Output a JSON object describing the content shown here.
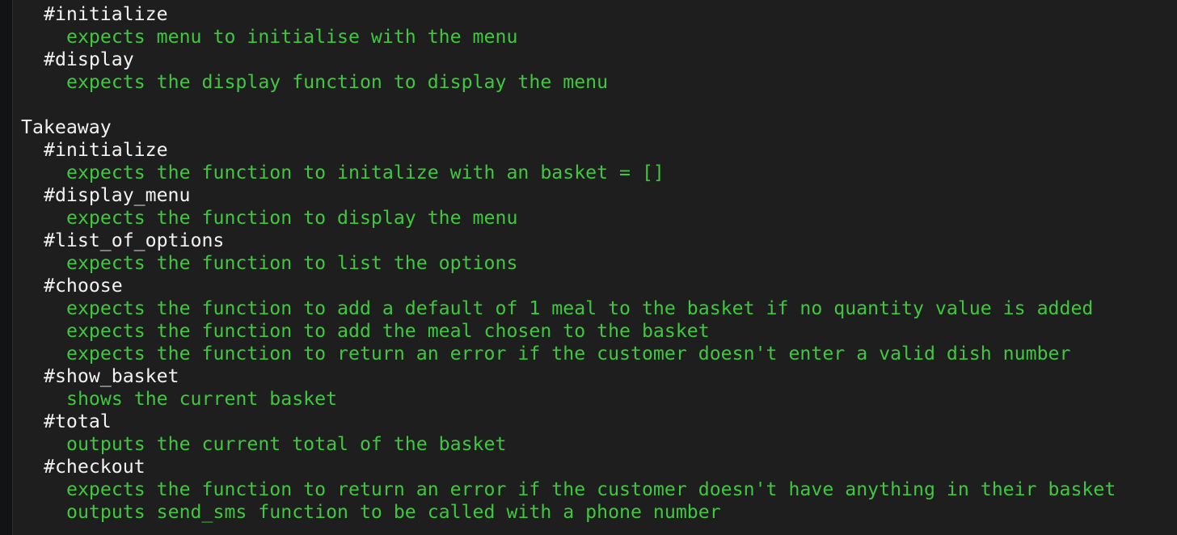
{
  "colors": {
    "background": "#1e1e1e",
    "heading_text": "#f2f2f2",
    "passing_spec_text": "#3fc83f"
  },
  "output": {
    "lines": [
      {
        "kind": "heading",
        "level": 1,
        "text": "#initialize"
      },
      {
        "kind": "pass",
        "level": 2,
        "text": "expects menu to initialise with the menu"
      },
      {
        "kind": "heading",
        "level": 1,
        "text": "#display"
      },
      {
        "kind": "pass",
        "level": 2,
        "text": "expects the display function to display the menu"
      },
      {
        "kind": "blank",
        "level": 0,
        "text": ""
      },
      {
        "kind": "heading",
        "level": 0,
        "text": "Takeaway"
      },
      {
        "kind": "heading",
        "level": 1,
        "text": "#initialize"
      },
      {
        "kind": "pass",
        "level": 2,
        "text": "expects the function to initalize with an basket = []"
      },
      {
        "kind": "heading",
        "level": 1,
        "text": "#display_menu"
      },
      {
        "kind": "pass",
        "level": 2,
        "text": "expects the function to display the menu"
      },
      {
        "kind": "heading",
        "level": 1,
        "text": "#list_of_options"
      },
      {
        "kind": "pass",
        "level": 2,
        "text": "expects the function to list the options"
      },
      {
        "kind": "heading",
        "level": 1,
        "text": "#choose"
      },
      {
        "kind": "pass",
        "level": 2,
        "text": "expects the function to add a default of 1 meal to the basket if no quantity value is added"
      },
      {
        "kind": "pass",
        "level": 2,
        "text": "expects the function to add the meal chosen to the basket"
      },
      {
        "kind": "pass",
        "level": 2,
        "text": "expects the function to return an error if the customer doesn't enter a valid dish number"
      },
      {
        "kind": "heading",
        "level": 1,
        "text": "#show_basket"
      },
      {
        "kind": "pass",
        "level": 2,
        "text": "shows the current basket"
      },
      {
        "kind": "heading",
        "level": 1,
        "text": "#total"
      },
      {
        "kind": "pass",
        "level": 2,
        "text": "outputs the current total of the basket"
      },
      {
        "kind": "heading",
        "level": 1,
        "text": "#checkout"
      },
      {
        "kind": "pass",
        "level": 2,
        "text": "expects the function to return an error if the customer doesn't have anything in their basket"
      },
      {
        "kind": "pass",
        "level": 2,
        "text": "outputs send_sms function to be called with a phone number"
      }
    ]
  }
}
